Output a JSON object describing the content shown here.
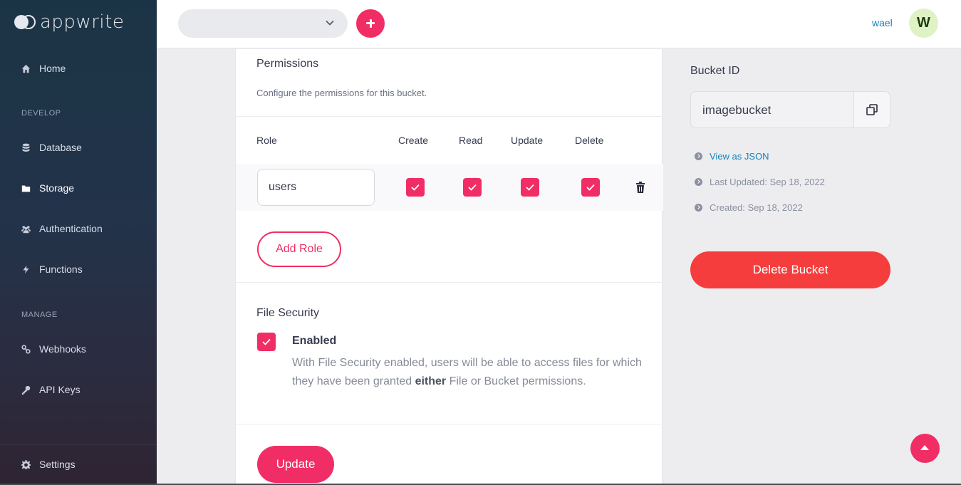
{
  "app": {
    "logo_text": "appwrite"
  },
  "sidebar": {
    "items": [
      {
        "label": "Home",
        "icon": "home-icon"
      },
      {
        "label": "Database",
        "icon": "database-icon"
      },
      {
        "label": "Storage",
        "icon": "folder-icon",
        "active": true
      },
      {
        "label": "Authentication",
        "icon": "users-icon"
      },
      {
        "label": "Functions",
        "icon": "bolt-icon"
      },
      {
        "label": "Webhooks",
        "icon": "link-icon"
      },
      {
        "label": "API Keys",
        "icon": "key-icon"
      }
    ],
    "sections": {
      "develop": "DEVELOP",
      "manage": "MANAGE"
    },
    "settings_label": "Settings"
  },
  "header": {
    "project_select_value": "",
    "user_name": "wael",
    "avatar_initial": "W"
  },
  "permissions": {
    "title": "Permissions",
    "subtitle": "Configure the permissions for this bucket.",
    "columns": [
      "Role",
      "Create",
      "Read",
      "Update",
      "Delete"
    ],
    "rows": [
      {
        "role": "users",
        "create": true,
        "read": true,
        "update": true,
        "delete": true
      }
    ],
    "add_role_label": "Add Role"
  },
  "file_security": {
    "title": "File Security",
    "enabled": true,
    "label": "Enabled",
    "desc_before": "With File Security enabled, users will be able to access files for which they have been granted ",
    "desc_bold": "either",
    "desc_after": " File or Bucket permissions."
  },
  "update_label": "Update",
  "bucket": {
    "id_label": "Bucket ID",
    "id_value": "imagebucket",
    "view_json": "View as JSON",
    "last_updated": "Last Updated: Sep 18, 2022",
    "created": "Created: Sep 18, 2022",
    "delete_label": "Delete Bucket"
  },
  "colors": {
    "accent": "#f02e65",
    "danger": "#f53d3d",
    "link": "#1483b8"
  }
}
